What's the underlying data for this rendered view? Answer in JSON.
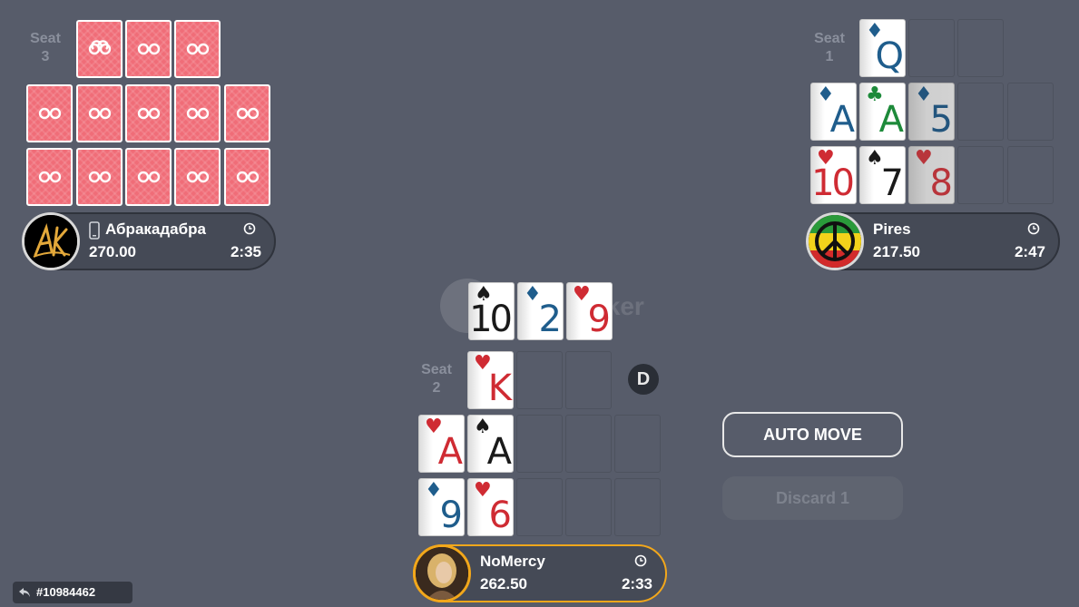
{
  "table": {
    "watermark": "Poker",
    "dealer_label": "D",
    "hand_id": "#10984462"
  },
  "seat3": {
    "label_word": "Seat",
    "label_num": "3",
    "player": {
      "name": "Абракадабра",
      "stack": "270.00",
      "time": "2:35"
    }
  },
  "seat1": {
    "label_word": "Seat",
    "label_num": "1",
    "player": {
      "name": "Pires",
      "stack": "217.50",
      "time": "2:47"
    },
    "cards": [
      {
        "rank": "Q",
        "suit": "♦"
      },
      {
        "rank": "A",
        "suit": "♦"
      },
      {
        "rank": "A",
        "suit": "♣"
      },
      {
        "rank": "5",
        "suit": "♦"
      },
      {
        "rank": "10",
        "suit": "♥"
      },
      {
        "rank": "7",
        "suit": "♠"
      },
      {
        "rank": "8",
        "suit": "♥"
      }
    ]
  },
  "seat2": {
    "label_word": "Seat",
    "label_num": "2",
    "player": {
      "name": "NoMercy",
      "stack": "262.50",
      "time": "2:33"
    },
    "cards": [
      {
        "rank": "K",
        "suit": "♥"
      },
      {
        "rank": "A",
        "suit": "♥"
      },
      {
        "rank": "A",
        "suit": "♠"
      },
      {
        "rank": "9",
        "suit": "♦"
      },
      {
        "rank": "6",
        "suit": "♥"
      }
    ]
  },
  "current_cards": [
    {
      "rank": "10",
      "suit": "♠"
    },
    {
      "rank": "2",
      "suit": "♦"
    },
    {
      "rank": "9",
      "suit": "♥"
    }
  ],
  "actions": {
    "auto_move": "AUTO MOVE",
    "discard": "Discard 1"
  },
  "colors": {
    "table_bg": "#575c6a",
    "active_border": "#f2a71b",
    "card_back": "#f06d78",
    "hearts": "#cf2b33",
    "diamonds": "#1f5d8c",
    "clubs": "#1d8a3a",
    "spades": "#1a1a1a"
  }
}
